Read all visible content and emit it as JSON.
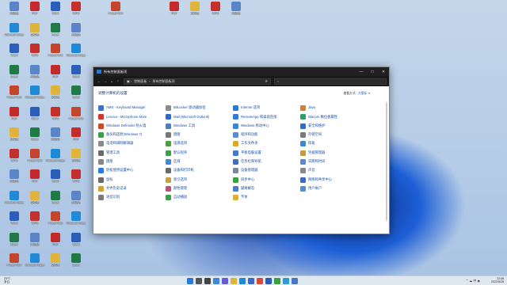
{
  "window": {
    "title": "所有控制面板项",
    "address": [
      "控制面板",
      "所有控制面板项"
    ],
    "search_placeholder": "",
    "heading": "调整计算机的设置",
    "view_by_label": "查看方式:",
    "view_by_value": "大图标"
  },
  "items": [
    {
      "label": "AMS - Keyboard Manager",
      "color": "#3c6fd0"
    },
    {
      "label": "BitLocker 驱动器加密",
      "color": "#8a8a8a"
    },
    {
      "label": "Internet 选项",
      "color": "#2a7ad8"
    },
    {
      "label": "Java",
      "color": "#e07b2c"
    },
    {
      "label": "Lenovo - Microphone Mute",
      "color": "#d0342c"
    },
    {
      "label": "Mail (Microsoft Outlook)",
      "color": "#2a6ad0"
    },
    {
      "label": "RemoteApp 和桌面连接",
      "color": "#2f7bd6"
    },
    {
      "label": "Wacom 数位板属性",
      "color": "#2aa06a"
    },
    {
      "label": "Windows Defender 防火墙",
      "color": "#c94a2a"
    },
    {
      "label": "Windows 工具",
      "color": "#4a7fc4"
    },
    {
      "label": "Windows 移动中心",
      "color": "#3b86d8"
    },
    {
      "label": "安全和维护",
      "color": "#2f6ec8"
    },
    {
      "label": "备份和还原(Windows 7)",
      "color": "#3aa046"
    },
    {
      "label": "键盘",
      "color": "#777"
    },
    {
      "label": "程序和功能",
      "color": "#5a8ad6"
    },
    {
      "label": "存储空间",
      "color": "#7a7a7a"
    },
    {
      "label": "电话和调制解调器",
      "color": "#8a8a8a"
    },
    {
      "label": "电源选项",
      "color": "#4aa040"
    },
    {
      "label": "工作文件夹",
      "color": "#d8a82a"
    },
    {
      "label": "恢复",
      "color": "#3a8ad0"
    },
    {
      "label": "管理工具",
      "color": "#6a6a6a"
    },
    {
      "label": "默认程序",
      "color": "#3ca04a"
    },
    {
      "label": "平板电脑设置",
      "color": "#4a78c8"
    },
    {
      "label": "凭据管理器",
      "color": "#c89a3a"
    },
    {
      "label": "键盘",
      "color": "#888"
    },
    {
      "label": "区域",
      "color": "#3a8ad8"
    },
    {
      "label": "任务栏和导航",
      "color": "#4a6ab8"
    },
    {
      "label": "日期和时间",
      "color": "#5a8ad0"
    },
    {
      "label": "轻松使用设置中心",
      "color": "#2f7ad8"
    },
    {
      "label": "设备和打印机",
      "color": "#6a6a6a"
    },
    {
      "label": "设备管理器",
      "color": "#7a8a9a"
    },
    {
      "label": "声音",
      "color": "#8a8a8a"
    },
    {
      "label": "鼠标",
      "color": "#6a6a6a"
    },
    {
      "label": "索引选项",
      "color": "#c8a040"
    },
    {
      "label": "同步中心",
      "color": "#3aa040"
    },
    {
      "label": "网络和共享中心",
      "color": "#3a6ac8"
    },
    {
      "label": "文件历史记录",
      "color": "#d8a02a"
    },
    {
      "label": "颜色管理",
      "color": "#c84a7a"
    },
    {
      "label": "疑难解答",
      "color": "#4a7ac8"
    },
    {
      "label": "用户帐户",
      "color": "#4a90d8"
    },
    {
      "label": "语音识别",
      "color": "#7a7a7a"
    },
    {
      "label": "自动播放",
      "color": "#3aa04a"
    },
    {
      "label": "字体",
      "color": "#d8b03a"
    }
  ],
  "desktop_icons": [
    {
      "label": "回收站",
      "color": "#5a86c8"
    },
    {
      "label": "Microsoft Edge",
      "color": "#1f8ad6"
    },
    {
      "label": "Word",
      "color": "#2b5eb8"
    },
    {
      "label": "Excel",
      "color": "#1f7a45"
    },
    {
      "label": "PowerPoint",
      "color": "#c4452c"
    },
    {
      "label": "PDF",
      "color": "#c42a2a"
    },
    {
      "label": "文件夹",
      "color": "#e0b33a"
    },
    {
      "label": "WPS",
      "color": "#c4302c"
    }
  ],
  "taskbar": {
    "weather_temp": "23°C",
    "weather_desc": "多云",
    "time": "22:06",
    "date": "2022/5/26",
    "icons": [
      {
        "name": "start",
        "color": "#2a7ad8"
      },
      {
        "name": "search",
        "color": "#555"
      },
      {
        "name": "taskview",
        "color": "#444"
      },
      {
        "name": "widgets",
        "color": "#3a8ad8"
      },
      {
        "name": "chat",
        "color": "#6a5ad8"
      },
      {
        "name": "explorer",
        "color": "#e0b33a"
      },
      {
        "name": "edge",
        "color": "#1f8ad6"
      },
      {
        "name": "store",
        "color": "#3a6ac8"
      },
      {
        "name": "chrome",
        "color": "#d84a3a"
      },
      {
        "name": "word",
        "color": "#2b5eb8"
      },
      {
        "name": "wechat",
        "color": "#3aa040"
      },
      {
        "name": "qq",
        "color": "#2a9ad8"
      },
      {
        "name": "control-panel",
        "color": "#4a78c8"
      }
    ]
  }
}
